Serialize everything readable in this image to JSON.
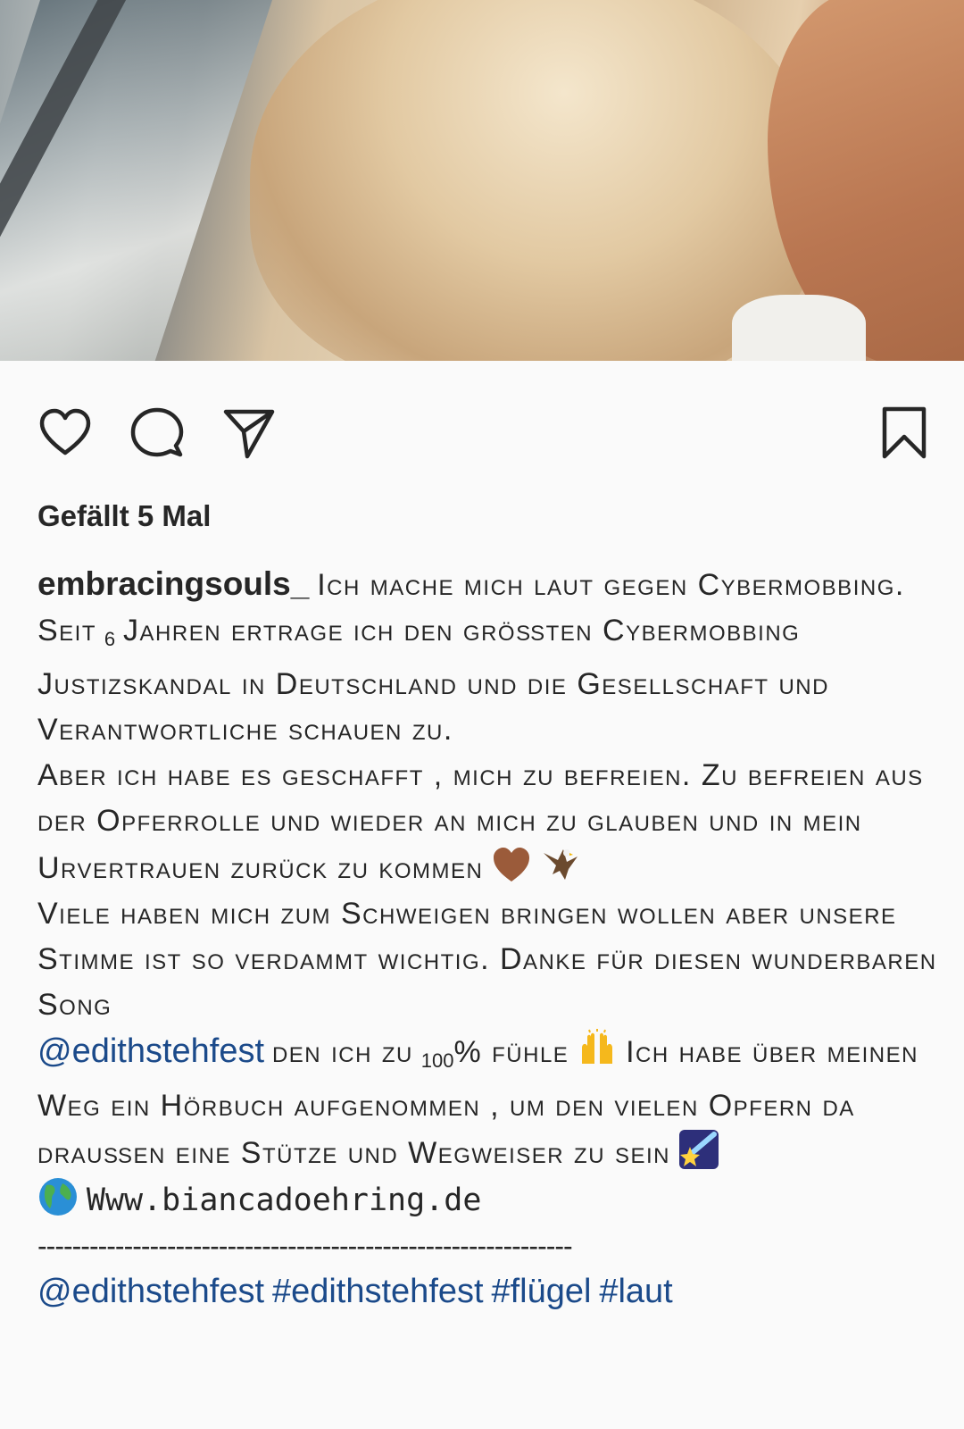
{
  "post": {
    "likes_text": "Gefällt 5 Mal",
    "username": "embracingsouls_",
    "caption": {
      "p1": "Ich mache mich laut gegen Cybermobbing. Seit",
      "p1_num": "6",
      "p2": "Jahren ertrage ich den größten Cybermobbing Justizskandal in Deutschland und die Gesellschaft und Verantwortliche schauen zu.",
      "p3": "Aber ich habe es geschafft ,  mich zu befreien. Zu befreien aus der Opferrolle und wieder an mich zu glauben und in mein Urvertrauen zurück zu kommen",
      "p4": "Viele haben mich zum Schweigen bringen wollen aber unsere Stimme ist so verdammt wichtig. Danke für diesen wunderbaren Song",
      "mention1": "@edithstehfest",
      "p5a": "den ich zu",
      "p5_num": "100",
      "p5b": "% fühle",
      "p6": "Ich habe über meinen Weg ein Hörbuch aufgenommen ,  um den vielen Opfern da draußen eine Stütze und Wegweiser zu sein",
      "website": "Www.biancadoehring.de",
      "divider": "--------------------------------------------------------------",
      "mention2": "@edithstehfest",
      "hashtag1": "#edithstehfest",
      "hashtag2": "#flügel",
      "hashtag3": "#laut"
    }
  },
  "icons": {
    "like": "heart-icon",
    "comment": "comment-icon",
    "share": "send-icon",
    "save": "bookmark-icon",
    "emoji_heart": "brown-heart-emoji",
    "emoji_eagle": "eagle-emoji",
    "emoji_hands": "raising-hands-emoji",
    "emoji_star": "shooting-star-emoji",
    "emoji_globe": "globe-emoji"
  },
  "colors": {
    "text": "#262626",
    "link": "#1b4a8a",
    "background": "#fafafa"
  }
}
